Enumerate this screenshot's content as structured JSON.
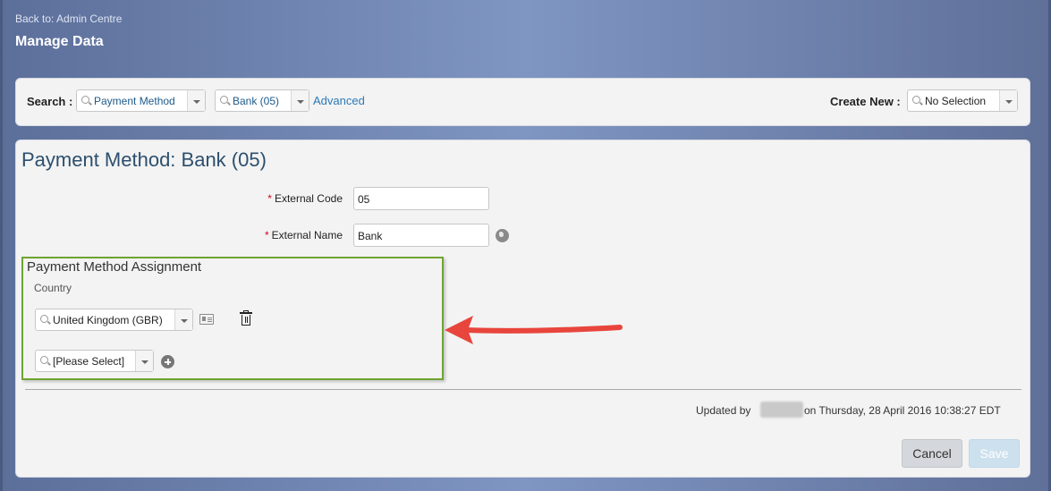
{
  "header": {
    "back_link": "Back to: Admin Centre",
    "title": "Manage Data"
  },
  "search_bar": {
    "search_label": "Search :",
    "object_type_value": "Payment Method",
    "record_value": "Bank (05)",
    "advanced_link": "Advanced",
    "create_new_label": "Create New :",
    "create_new_value": "No Selection"
  },
  "record": {
    "title": "Payment Method: Bank (05)",
    "fields": {
      "external_code": {
        "required_mark": "*",
        "label": "External Code",
        "value": "05"
      },
      "external_name": {
        "required_mark": "*",
        "label": "External Name",
        "value": "Bank"
      }
    },
    "assignment": {
      "title": "Payment Method Assignment",
      "column_label": "Country",
      "rows": [
        {
          "value": "United Kingdom  (GBR)"
        }
      ],
      "new_row_placeholder": "[Please Select]"
    },
    "updated_prefix": "Updated by",
    "updated_suffix": "on Thursday, 28 April 2016 10:38:27 EDT",
    "buttons": {
      "cancel": "Cancel",
      "save": "Save"
    }
  },
  "annotation": {
    "arrow_color": "#e8453c",
    "highlight_color": "#6ea431"
  }
}
